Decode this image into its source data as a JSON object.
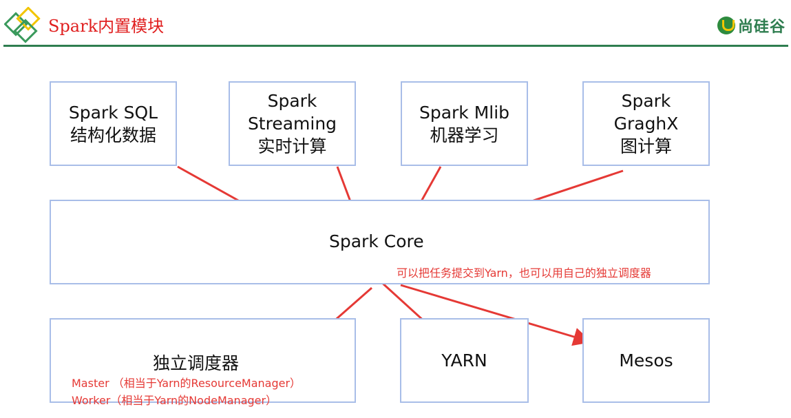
{
  "header": {
    "title": "Spark内置模块",
    "brand": "尚硅谷"
  },
  "top_modules": [
    {
      "line1": "Spark SQL",
      "line2": "结构化数据"
    },
    {
      "line1": "Spark",
      "line2": "Streaming",
      "line3": "实时计算"
    },
    {
      "line1": "Spark Mlib",
      "line2": "机器学习"
    },
    {
      "line1": "Spark",
      "line2": "GraghX",
      "line3": "图计算"
    }
  ],
  "core": {
    "label": "Spark Core",
    "note": "可以把任务提交到Yarn，也可以用自己的独立调度器"
  },
  "schedulers": [
    {
      "label": "独立调度器",
      "notes": [
        "Master （相当于Yarn的ResourceManager）",
        "Worker（相当于Yarn的NodeManager）"
      ]
    },
    {
      "label": "YARN"
    },
    {
      "label": "Mesos"
    }
  ],
  "colors": {
    "title": "#e02020",
    "header_line": "#2e7d4f",
    "box_border": "#a8bde8",
    "arrow": "#e53935",
    "note": "#e53935"
  }
}
